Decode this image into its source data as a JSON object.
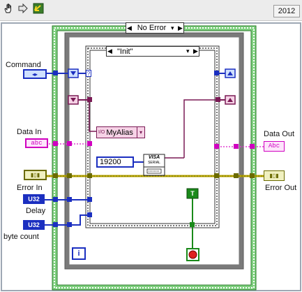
{
  "toolbar": {
    "run_icon": "hand-icon",
    "arrow_icon": "arrow-right-icon",
    "step_icon": "step-icon",
    "year": "2012"
  },
  "case_structure": {
    "outer_selector": "No Error",
    "inner_selector": "\"Init\""
  },
  "terminals": {
    "command": "Command",
    "data_in": "Data In",
    "error_in": "Error In",
    "delay": "Delay",
    "byte_count": "byte count",
    "data_out": "Data Out",
    "error_out": "Error Out",
    "u32_a": "U32",
    "u32_b": "U32",
    "abc_in": "abc",
    "abc_out": "Abc"
  },
  "visa": {
    "resource_name": "MyAlias",
    "resource_prefix": "I/O",
    "baud_rate": "19200",
    "node_line1": "VISA",
    "node_line2": "SERIAL"
  },
  "loop": {
    "iteration_label": "i",
    "true_constant": "T"
  },
  "colors": {
    "error_cluster": "#6b6b00",
    "numeric_u32": "#1b2fc0",
    "string_wire": "#d000c0",
    "visa_wire": "#7a1a55",
    "green": "#1a8a1a",
    "loop_gray": "#808080"
  }
}
